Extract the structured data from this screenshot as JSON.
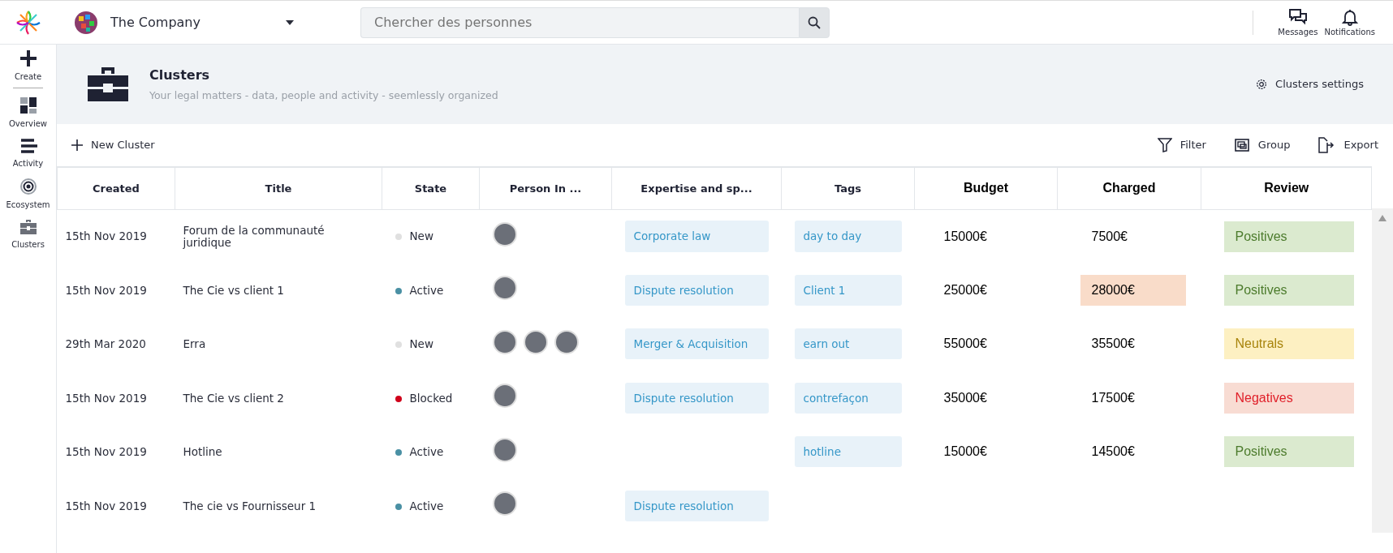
{
  "topbar": {
    "company": "The Company",
    "search": {
      "placeholder": "Chercher des personnes"
    },
    "actions": [
      {
        "label": "Messages",
        "kind": "messages"
      },
      {
        "label": "Notifications",
        "kind": "bell"
      }
    ]
  },
  "sidebar": {
    "items": [
      {
        "label": "Create",
        "kind": "plus"
      },
      {
        "label": "Overview",
        "kind": "grid"
      },
      {
        "label": "Activity",
        "kind": "lines"
      },
      {
        "label": "Ecosystem",
        "kind": "orbit"
      },
      {
        "label": "Clusters",
        "kind": "case"
      }
    ]
  },
  "header": {
    "title": "Clusters",
    "subtitle": "Your legal matters - data, people and activity - seemlessly organized",
    "settings": "Clusters settings"
  },
  "toolbar": {
    "new": "New Cluster",
    "actions": [
      {
        "label": "Filter",
        "kind": "filter"
      },
      {
        "label": "Group",
        "kind": "group"
      },
      {
        "label": "Export",
        "kind": "export"
      }
    ]
  },
  "table": {
    "columns": [
      {
        "label": "Created",
        "kind": "app"
      },
      {
        "label": "Title",
        "kind": "app"
      },
      {
        "label": "State",
        "kind": "app"
      },
      {
        "label": "Person In ...",
        "kind": "app"
      },
      {
        "label": "Expertise and sp...",
        "kind": "app"
      },
      {
        "label": "Tags",
        "kind": "app"
      },
      {
        "label": "Budget",
        "kind": "sheet"
      },
      {
        "label": "Charged",
        "kind": "sheet"
      },
      {
        "label": "Review",
        "kind": "sheet"
      }
    ],
    "rows": [
      {
        "created": "15th Nov 2019",
        "title": "Forum de la communauté juridique",
        "state": {
          "label": "New",
          "color": "#e0e0e0"
        },
        "people": [
          {
            "kind": "avatar"
          }
        ],
        "expertise": "Corporate law",
        "tag": "day to day",
        "budget": "15000€",
        "charged": "7500€",
        "charged_over": false,
        "review": {
          "label": "Positives",
          "kind": "positive"
        }
      },
      {
        "created": "15th Nov 2019",
        "title": "The Cie vs client 1",
        "state": {
          "label": "Active",
          "color": "#4a90a4"
        },
        "people": [
          {
            "kind": "avatar"
          }
        ],
        "expertise": "Dispute resolution",
        "tag": "Client 1",
        "budget": "25000€",
        "charged": "28000€",
        "charged_over": true,
        "review": {
          "label": "Positives",
          "kind": "positive"
        }
      },
      {
        "created": "29th Mar 2020",
        "title": "Erra",
        "state": {
          "label": "New",
          "color": "#e0e0e0"
        },
        "people": [
          {
            "kind": "avatar"
          },
          {
            "kind": "avatar"
          },
          {
            "kind": "avatar"
          }
        ],
        "expertise": "Merger & Acquisition",
        "tag": "earn out",
        "budget": "55000€",
        "charged": "35500€",
        "charged_over": false,
        "review": {
          "label": "Neutrals",
          "kind": "neutral"
        }
      },
      {
        "created": "15th Nov 2019",
        "title": "The Cie vs client 2",
        "state": {
          "label": "Blocked",
          "color": "#d0021b"
        },
        "people": [
          {
            "kind": "avatar"
          }
        ],
        "expertise": "Dispute resolution",
        "tag": "contrefaçon",
        "budget": "35000€",
        "charged": "17500€",
        "charged_over": false,
        "review": {
          "label": "Negatives",
          "kind": "negative"
        }
      },
      {
        "created": "15th Nov 2019",
        "title": "Hotline",
        "state": {
          "label": "Active",
          "color": "#4a90a4"
        },
        "people": [
          {
            "kind": "avatar"
          }
        ],
        "tag": "hotline",
        "budget": "15000€",
        "charged": "14500€",
        "charged_over": false,
        "review": {
          "label": "Positives",
          "kind": "positive"
        }
      },
      {
        "created": "15th Nov 2019",
        "title": "The cie vs Fournisseur 1",
        "state": {
          "label": "Active",
          "color": "#4a90a4"
        },
        "people": [
          {
            "kind": "avatar"
          }
        ],
        "expertise": "Dispute resolution"
      }
    ]
  }
}
